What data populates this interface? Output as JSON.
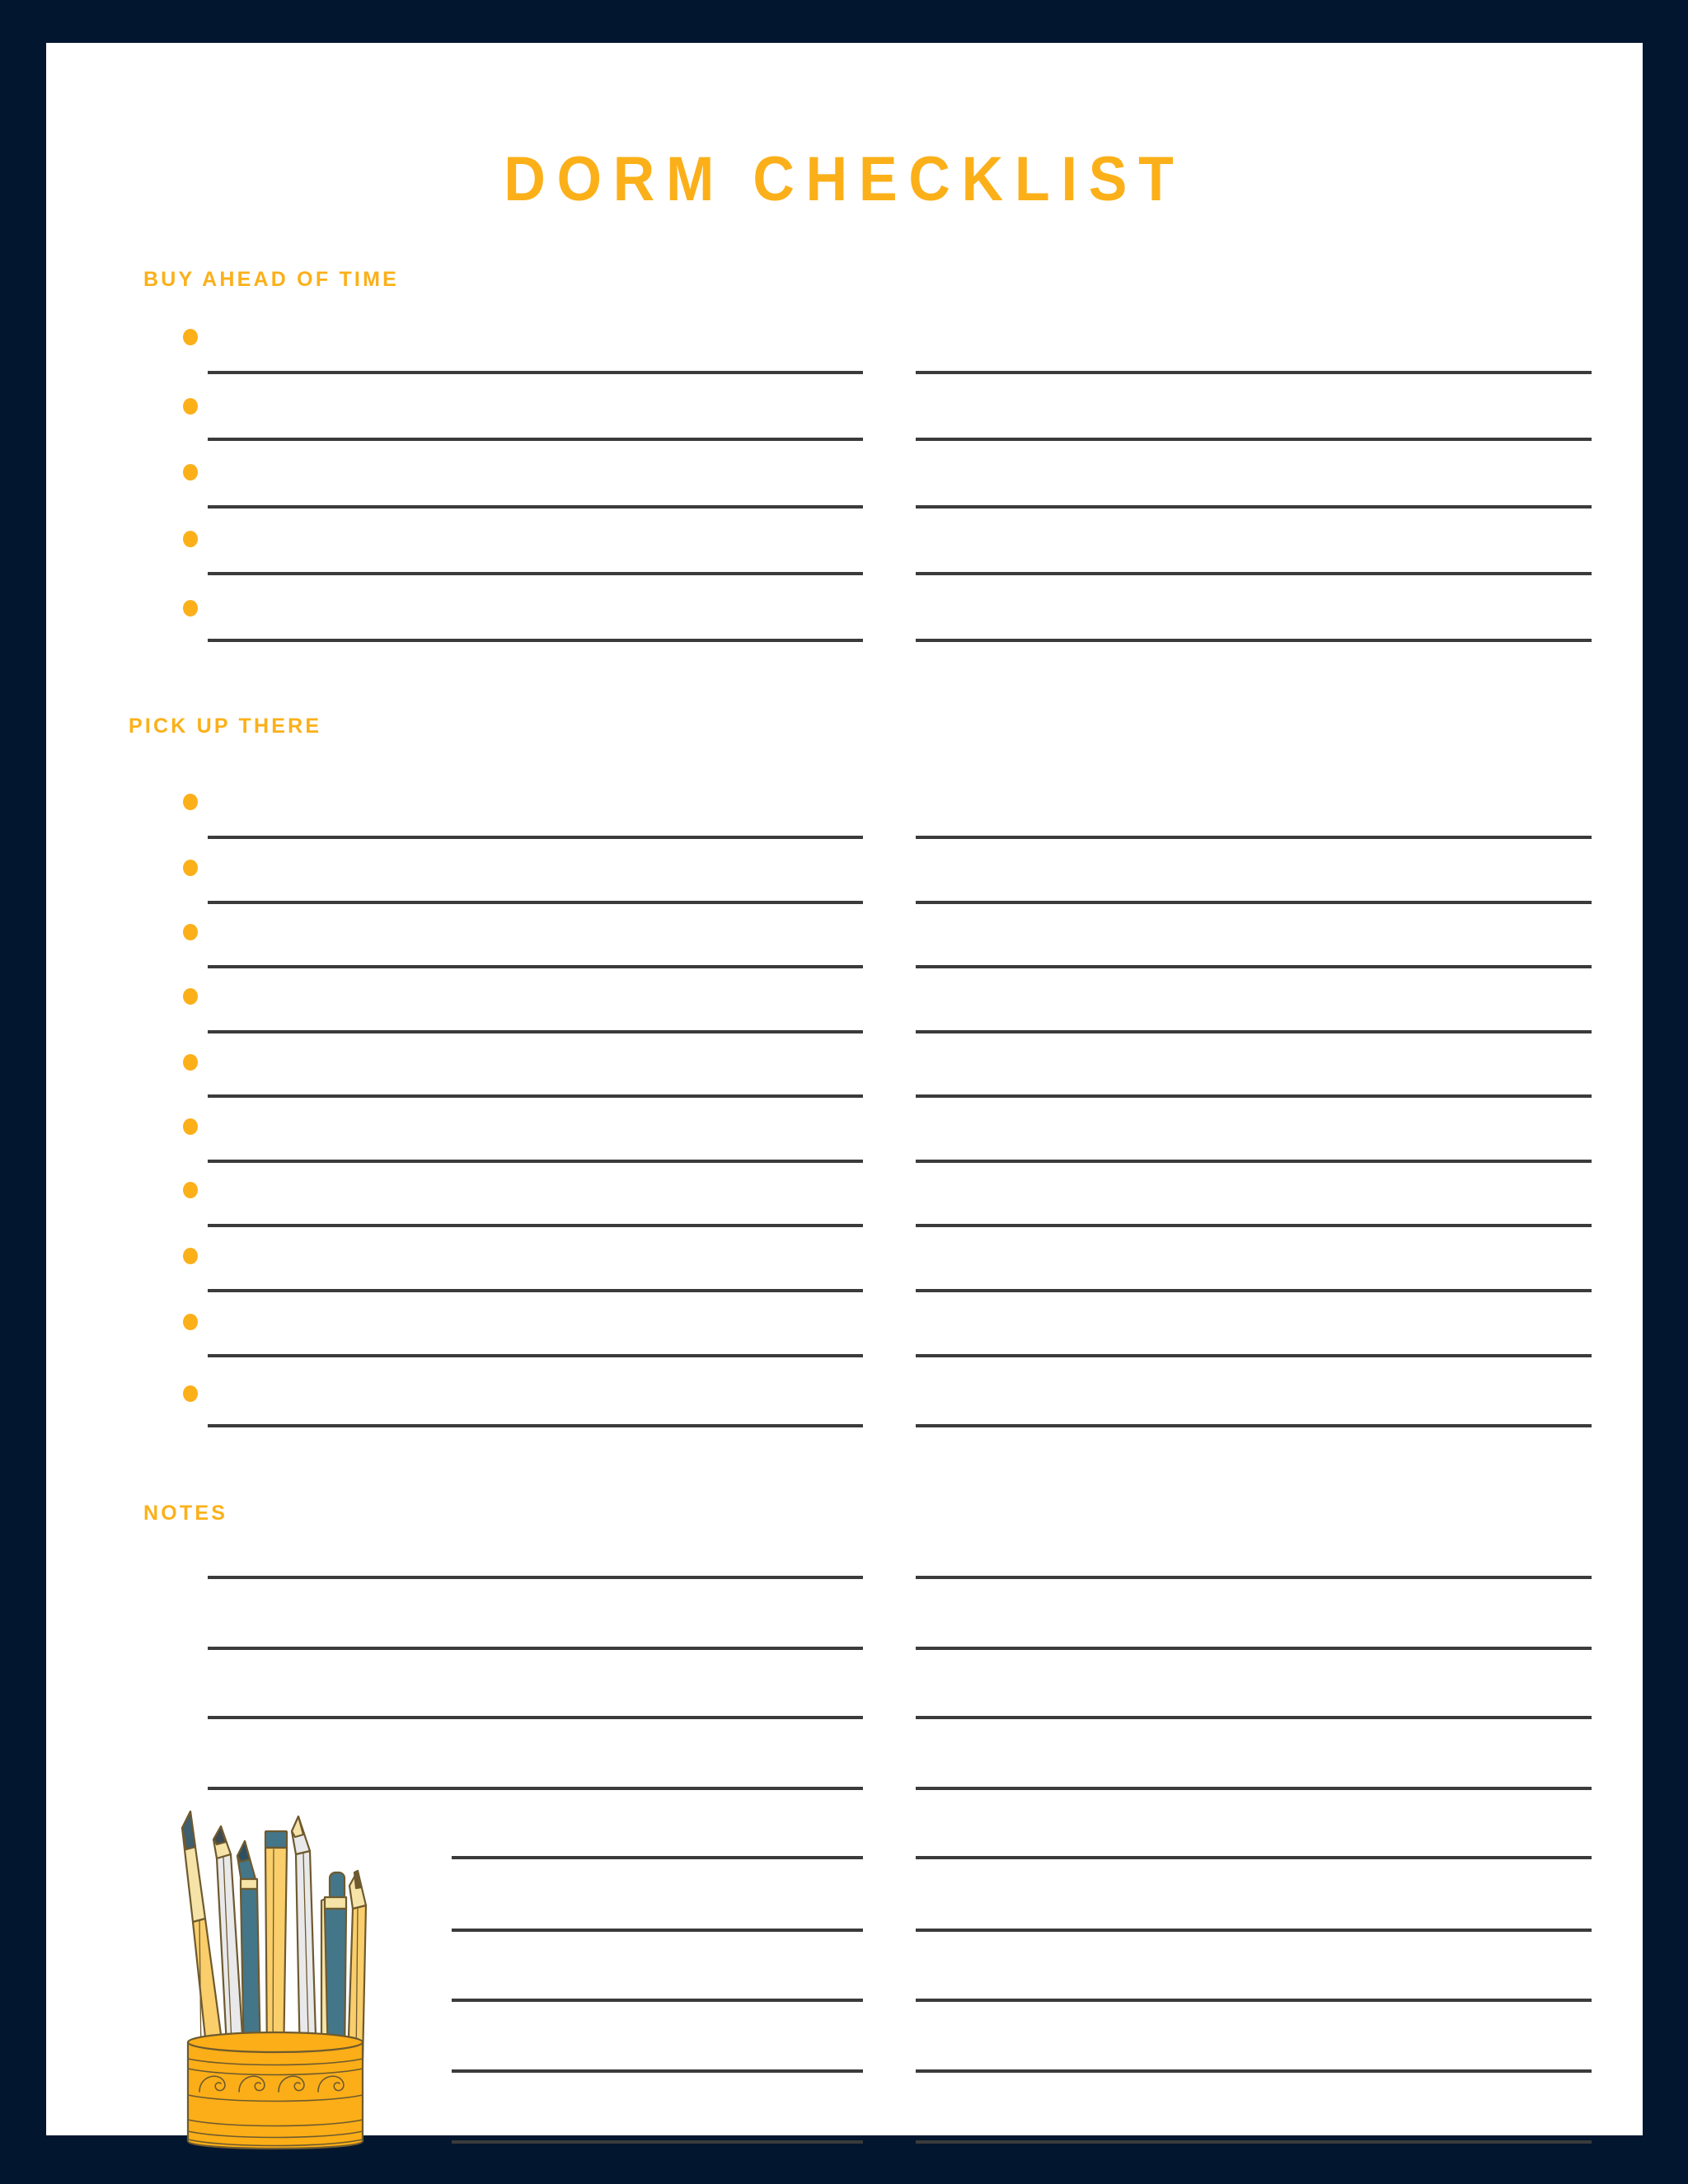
{
  "document": {
    "title": "DORM CHECKLIST",
    "accent_color": "#FBB01A",
    "border_color": "#03162F",
    "line_color": "#3B3B3B",
    "paper_color": "#FFFFFF"
  },
  "sections": [
    {
      "id": "buy-ahead-of-time",
      "heading": "BUY AHEAD OF TIME",
      "bullets": 5,
      "left_lines": 5,
      "right_lines": 5
    },
    {
      "id": "pick-up-there",
      "heading": "PICK UP THERE",
      "bullets": 10,
      "left_lines": 10,
      "right_lines": 10
    },
    {
      "id": "notes",
      "heading": "NOTES",
      "bullets": 0,
      "left_lines": 9,
      "right_lines": 9
    }
  ],
  "illustration": {
    "name": "pencil-cup",
    "cup_color": "#FBAE17",
    "cup_outline": "#6E5A2E",
    "items": [
      {
        "name": "pencil-yellow-left",
        "body": "#F9CE6B",
        "tip": "#F6E3A8",
        "lead": "#44768A"
      },
      {
        "name": "pencil-white-1",
        "body": "#E9E9EB",
        "tip": "#F6E3A8",
        "lead": "#3F4A52"
      },
      {
        "name": "pencil-teal",
        "body": "#44768A",
        "tip": "#44768A",
        "lead": "#2E4F60",
        "band": "#F6E3A8"
      },
      {
        "name": "pencil-yellow-flat",
        "body": "#F9CE6B",
        "cap": "#44768A"
      },
      {
        "name": "pencil-white-2",
        "body": "#E9E9EB",
        "tip": "#F6E3A8",
        "lead": "#F6E3A8"
      },
      {
        "name": "pen-teal",
        "body": "#44768A",
        "clip": "#F6E3A8",
        "cap": "#44768A"
      },
      {
        "name": "pencil-yellow-right",
        "body": "#F9CE6B",
        "tip": "#F6E3A8",
        "lead": "#6E5A2E"
      }
    ]
  }
}
